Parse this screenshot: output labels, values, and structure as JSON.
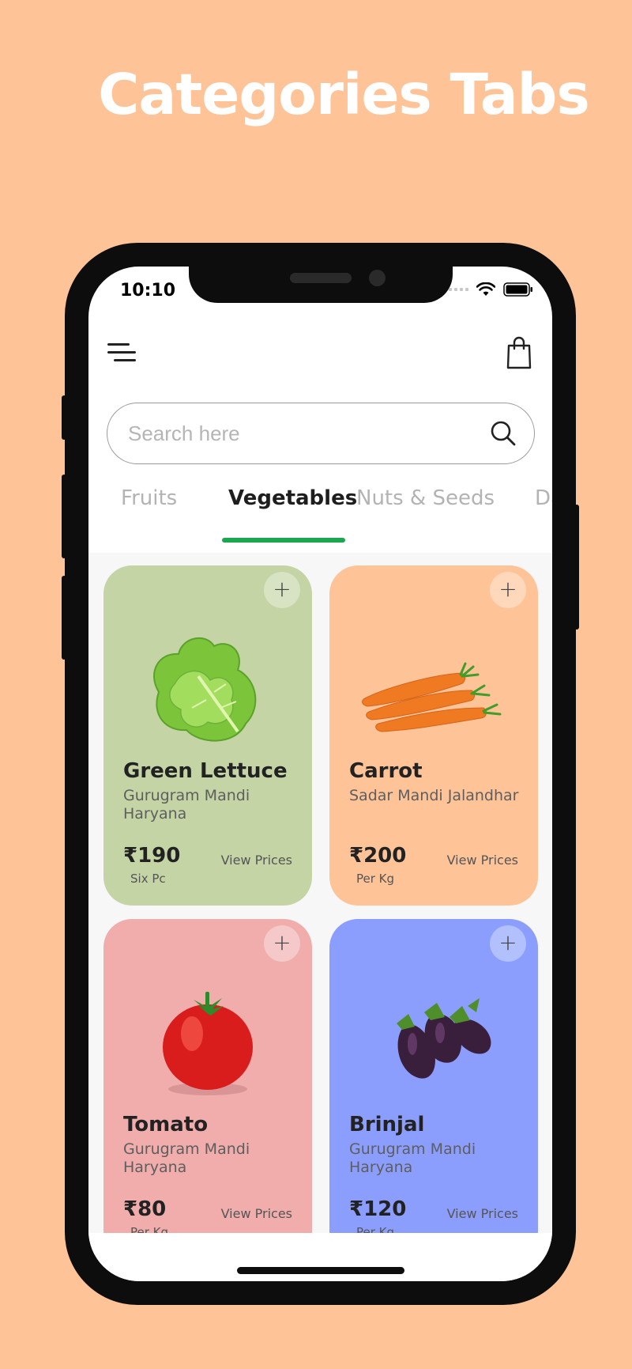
{
  "hero": {
    "title": "Categories Tabs"
  },
  "status_bar": {
    "time": "10:10"
  },
  "search": {
    "placeholder": "Search here"
  },
  "tabs": [
    {
      "label": "Fruits",
      "active": false
    },
    {
      "label": "Vegetables",
      "active": true
    },
    {
      "label": "Nuts & Seeds",
      "active": false
    },
    {
      "label": "Da",
      "active": false
    }
  ],
  "products": [
    {
      "name": "Green Lettuce",
      "market": "Gurugram Mandi Haryana",
      "price": "₹190",
      "unit": "Six Pc",
      "action": "View Prices",
      "bg_color": "#c4d4a5",
      "icon": "lettuce"
    },
    {
      "name": "Carrot",
      "market": "Sadar Mandi Jalandhar",
      "price": "₹200",
      "unit": "Per Kg",
      "action": "View Prices",
      "bg_color": "#ffc398",
      "icon": "carrot"
    },
    {
      "name": "Tomato",
      "market": "Gurugram Mandi Haryana",
      "price": "₹80",
      "unit": "Per Kg",
      "action": "View Prices",
      "bg_color": "#f0adac",
      "icon": "tomato"
    },
    {
      "name": "Brinjal",
      "market": "Gurugram Mandi Haryana",
      "price": "₹120",
      "unit": "Per Kg",
      "action": "View Prices",
      "bg_color": "#8b9efe",
      "icon": "brinjal"
    }
  ],
  "colors": {
    "page_bg": "#ffc398",
    "accent": "#1ca64e"
  }
}
